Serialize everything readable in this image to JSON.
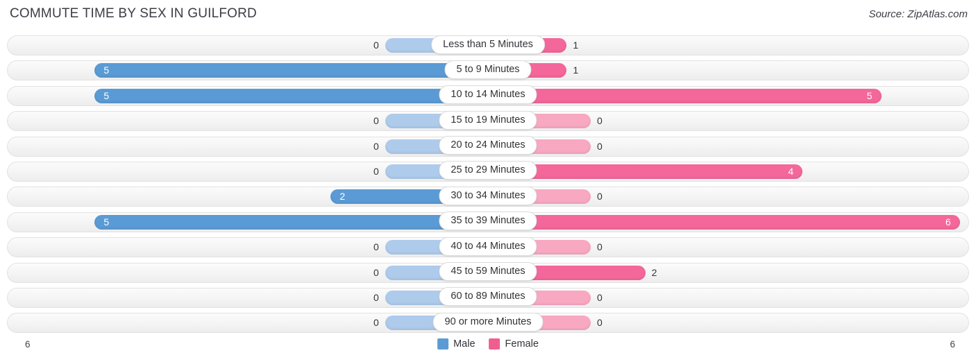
{
  "header": {
    "title": "COMMUTE TIME BY SEX IN GUILFORD",
    "source": "Source: ZipAtlas.com"
  },
  "axis": {
    "left_max_label": "6",
    "right_max_label": "6"
  },
  "legend": {
    "items": [
      {
        "label": "Male",
        "color": "#5b9bd5"
      },
      {
        "label": "Female",
        "color": "#ee5f90"
      }
    ]
  },
  "colors": {
    "male_strong": "#5b9bd5",
    "male_light": "#aecbec",
    "female_strong": "#f4679a",
    "female_light": "#f9a8c2",
    "track": "#f4f4f4"
  },
  "chart_data": {
    "type": "bar",
    "subtype": "diverging-horizontal-butterfly",
    "title": "COMMUTE TIME BY SEX IN GUILFORD",
    "xlabel": "",
    "ylabel": "",
    "xlim": [
      0,
      6
    ],
    "grid": false,
    "legend_position": "bottom-center",
    "categories": [
      "Less than 5 Minutes",
      "5 to 9 Minutes",
      "10 to 14 Minutes",
      "15 to 19 Minutes",
      "20 to 24 Minutes",
      "25 to 29 Minutes",
      "30 to 34 Minutes",
      "35 to 39 Minutes",
      "40 to 44 Minutes",
      "45 to 59 Minutes",
      "60 to 89 Minutes",
      "90 or more Minutes"
    ],
    "series": [
      {
        "name": "Male",
        "direction": "left",
        "values": [
          0,
          5,
          5,
          0,
          0,
          0,
          2,
          5,
          0,
          0,
          0,
          0
        ]
      },
      {
        "name": "Female",
        "direction": "right",
        "values": [
          1,
          1,
          5,
          0,
          0,
          4,
          0,
          6,
          0,
          2,
          0,
          0
        ]
      }
    ]
  },
  "rows": [
    {
      "label": "Less than 5 Minutes",
      "male": "0",
      "female": "1"
    },
    {
      "label": "5 to 9 Minutes",
      "male": "5",
      "female": "1"
    },
    {
      "label": "10 to 14 Minutes",
      "male": "5",
      "female": "5"
    },
    {
      "label": "15 to 19 Minutes",
      "male": "0",
      "female": "0"
    },
    {
      "label": "20 to 24 Minutes",
      "male": "0",
      "female": "0"
    },
    {
      "label": "25 to 29 Minutes",
      "male": "0",
      "female": "4"
    },
    {
      "label": "30 to 34 Minutes",
      "male": "2",
      "female": "0"
    },
    {
      "label": "35 to 39 Minutes",
      "male": "5",
      "female": "6"
    },
    {
      "label": "40 to 44 Minutes",
      "male": "0",
      "female": "0"
    },
    {
      "label": "45 to 59 Minutes",
      "male": "0",
      "female": "2"
    },
    {
      "label": "60 to 89 Minutes",
      "male": "0",
      "female": "0"
    },
    {
      "label": "90 or more Minutes",
      "male": "0",
      "female": "0"
    }
  ]
}
